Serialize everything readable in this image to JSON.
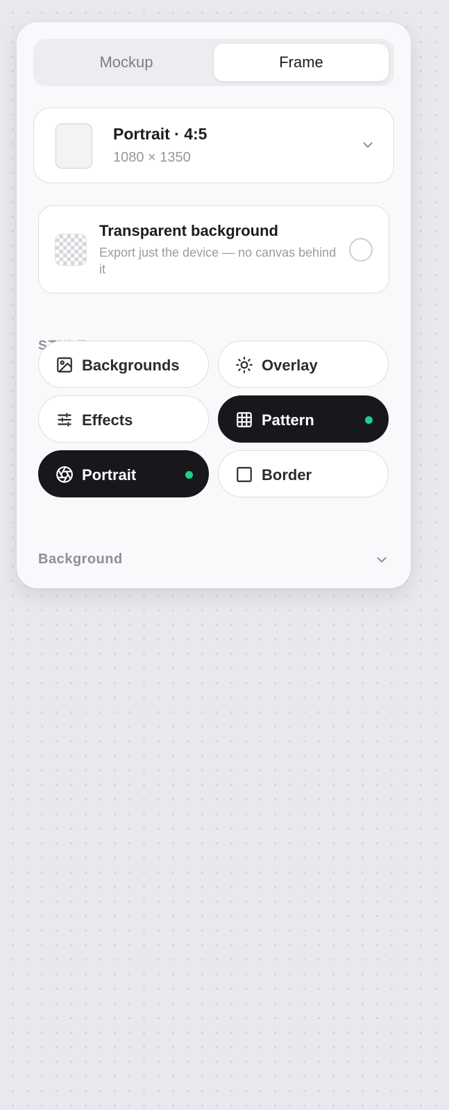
{
  "tabs": {
    "mockup_label": "Mockup",
    "frame_label": "Frame",
    "selected": "Frame"
  },
  "canvas_size": {
    "title": "Portrait · 4:5",
    "dimensions": "1080 × 1350"
  },
  "transparent_background": {
    "title": "Transparent background",
    "description": "Export just the device — no canvas behind it",
    "enabled": false
  },
  "style": {
    "heading": "STYLE",
    "chips": [
      {
        "label": "Backgrounds",
        "icon": "image-icon",
        "active": false
      },
      {
        "label": "Overlay",
        "icon": "sun-icon",
        "active": false
      },
      {
        "label": "Effects",
        "icon": "sliders-icon",
        "active": false
      },
      {
        "label": "Pattern",
        "icon": "grid-icon",
        "active": true
      },
      {
        "label": "Portrait",
        "icon": "aperture-icon",
        "active": true
      },
      {
        "label": "Border",
        "icon": "square-icon",
        "active": false
      }
    ]
  },
  "background_section": {
    "label": "Background"
  },
  "colors": {
    "active_chip": "#18181c",
    "active_dot": "#1fd08a",
    "page_background": "#e8e9ee"
  }
}
